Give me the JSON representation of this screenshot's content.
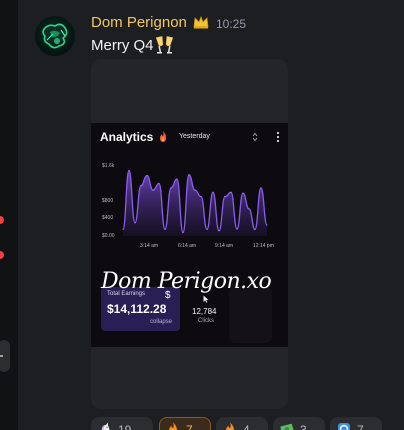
{
  "message": {
    "username": "Dom Perignon",
    "timestamp": "10:25",
    "text": "Merry Q4",
    "username_color": "#f0c85a",
    "badge_icon": "crown-icon",
    "text_emoji_icon": "clinking-glasses-icon"
  },
  "attachment": {
    "title": "Analytics",
    "period": "Yesterday",
    "y_labels": [
      "$1.6k",
      "$800",
      "$400",
      "$0.00"
    ],
    "x_labels": [
      "3:14 am",
      "6:14 am",
      "9:14 am",
      "12:14 pm"
    ],
    "watermark": "Dom Perigon.xo",
    "earnings_label": "Total Earnings",
    "earnings_value": "$14,112.28",
    "collapse_label": "collapse",
    "clicks_value": "12,784",
    "clicks_label": "Clicks",
    "accent_color": "#8a5cf0"
  },
  "chart_data": {
    "type": "area",
    "title": "",
    "xlabel": "",
    "ylabel": "",
    "x_ticks": [
      "3:14 am",
      "6:14 am",
      "9:14 am",
      "12:14 pm"
    ],
    "y_ticks": [
      "$1.6k",
      "$800",
      "$400",
      "$0.00"
    ],
    "ylim": [
      0,
      1600
    ],
    "series": [
      {
        "values": [
          150,
          1500,
          300,
          1150,
          1380,
          1050,
          1200,
          150,
          1100,
          1300,
          80,
          1400,
          1050,
          900,
          150,
          1000,
          120,
          900,
          1000,
          160,
          980,
          620,
          150,
          1100,
          250
        ]
      }
    ]
  },
  "reactions": [
    {
      "emoji": "unicorn-icon",
      "count": "19"
    },
    {
      "emoji": "fire-icon",
      "count": "7"
    },
    {
      "emoji": "fire-icon",
      "count": "4"
    },
    {
      "emoji": "money-icon",
      "count": "3"
    },
    {
      "emoji": "blue-emoji-icon",
      "count": "7"
    }
  ]
}
